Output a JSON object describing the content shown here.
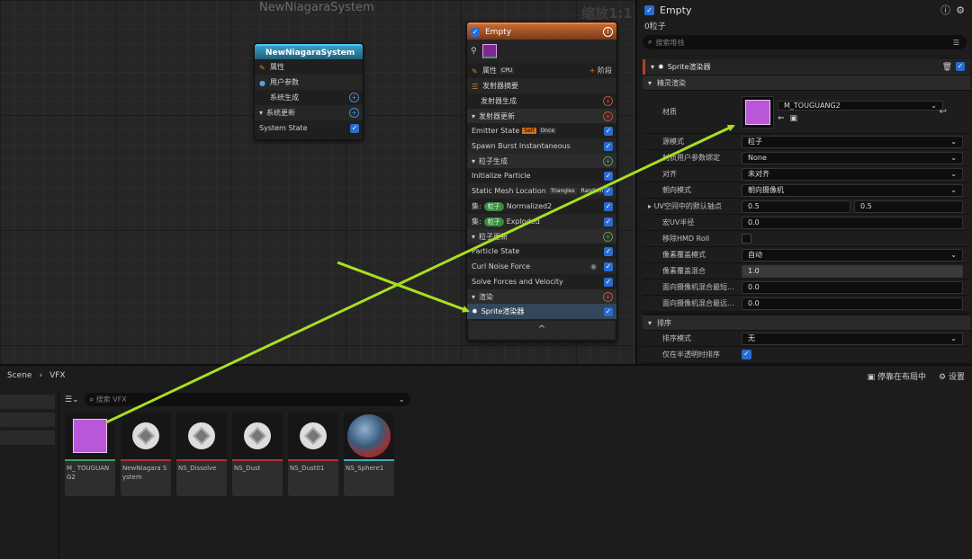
{
  "graph": {
    "title": "NewNiagaraSystem",
    "zoom": "缩放1:1"
  },
  "system_node": {
    "title": "NewNiagaraSystem",
    "rows": [
      "属性",
      "用户参数",
      "系统生成",
      "系统更新",
      "System State"
    ]
  },
  "emitter_node": {
    "title": "Empty",
    "props_label": "属性",
    "cpu_badge": "CPU",
    "stage_label": "阶段",
    "summary": "发射器摘要",
    "emitter_spawn": "发射器生成",
    "emitter_update": "发射器更新",
    "emitter_state": "Emitter State",
    "badge_self": "Self",
    "badge_once": "Once",
    "spawn_burst": "Spawn Burst Instantaneous",
    "particle_spawn": "粒子生成",
    "init_particle": "Initialize Particle",
    "static_mesh": "Static Mesh Location",
    "badge_triangles": "Triangles",
    "badge_random": "Random",
    "set_label_1": "集:",
    "pill_1": "粒子",
    "set_value_1": "Normalized2",
    "set_label_2": "集:",
    "pill_2": "粒子",
    "set_value_2": "Exploded",
    "particle_update": "粒子更新",
    "particle_state": "Particle State",
    "curl_noise": "Curl Noise Force",
    "solve_forces": "Solve Forces and Velocity",
    "render": "渲染",
    "sprite_renderer": "Sprite渲染器",
    "footer": "^"
  },
  "details": {
    "title": "Empty",
    "subtitle": "0粒子",
    "search_placeholder": "搜索堆栈",
    "component": "Sprite渲染器",
    "cat_sprite": "精灵渲染",
    "material_label": "材质",
    "material_value": "M_TOUGUANG2",
    "rows": [
      {
        "label": "源模式",
        "value": "粒子"
      },
      {
        "label": "材质用户参数绑定",
        "value": "None"
      },
      {
        "label": "对齐",
        "value": "未对齐"
      },
      {
        "label": "朝向模式",
        "value": "朝向摄像机"
      }
    ],
    "pivot_label": "UV空间中的默认轴点",
    "pivot_x": "0.5",
    "pivot_y": "0.5",
    "macro_uv_label": "宏UV半径",
    "macro_uv_value": "0.0",
    "hmd_label": "移除HMD Roll",
    "pixel_mode_label": "像素覆盖模式",
    "pixel_mode_value": "自动",
    "pixel_blend_label": "像素覆盖混合",
    "pixel_blend_value": "1.0",
    "cam_blend_1_label": "面向摄像机混合最短...",
    "cam_blend_1_value": "0.0",
    "cam_blend_2_label": "面向摄像机混合最远...",
    "cam_blend_2_value": "0.0",
    "cat_sort": "排序",
    "sort_mode_label": "排序模式",
    "sort_mode_value": "无",
    "translucent_sort_label": "仅在半透明时排序"
  },
  "content_browser": {
    "crumb_1": "Scene",
    "crumb_2": "VFX",
    "dock_label": "停靠在布局中",
    "settings_label": "设置",
    "search_placeholder": "搜索 VFX",
    "assets": [
      {
        "name": "M_ TOUGUANG2",
        "strip": "#3aa060",
        "kind": "material"
      },
      {
        "name": "NewNiagara System",
        "strip": "#b03030",
        "kind": "system"
      },
      {
        "name": "NS_Dissolve",
        "strip": "#b03030",
        "kind": "system"
      },
      {
        "name": "NS_Dust",
        "strip": "#b03030",
        "kind": "system"
      },
      {
        "name": "NS_Dust01",
        "strip": "#b03030",
        "kind": "system"
      },
      {
        "name": "NS_Sphere1",
        "strip": "#3ab0c0",
        "kind": "sphere"
      }
    ]
  }
}
